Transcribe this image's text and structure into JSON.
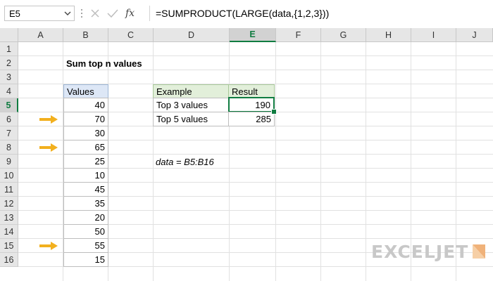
{
  "formula_bar": {
    "name_box": "E5",
    "fx_symbol": "fx",
    "formula": "=SUMPRODUCT(LARGE(data,{1,2,3}))"
  },
  "grid": {
    "columns": [
      "A",
      "B",
      "C",
      "D",
      "E",
      "F",
      "G",
      "H",
      "I",
      "J"
    ],
    "rows": [
      "1",
      "2",
      "3",
      "4",
      "5",
      "6",
      "7",
      "8",
      "9",
      "10",
      "11",
      "12",
      "13",
      "14",
      "15",
      "16"
    ],
    "selected_column": "E",
    "selected_row": "5"
  },
  "sheet": {
    "title": "Sum top n values",
    "values_header": "Values",
    "values": [
      "40",
      "70",
      "30",
      "65",
      "25",
      "10",
      "45",
      "35",
      "20",
      "50",
      "55",
      "15"
    ],
    "highlighted_values": [
      "70",
      "65",
      "55"
    ],
    "table": {
      "headers": [
        "Example",
        "Result"
      ],
      "rows": [
        {
          "example": "Top 3 values",
          "result": "190"
        },
        {
          "example": "Top 5 values",
          "result": "285"
        }
      ]
    },
    "note": "data = B5:B16"
  },
  "branding": {
    "logo_text": "EXCELJET"
  },
  "colors": {
    "arrow": "#f2b01e",
    "selection": "#107c41",
    "values_header_fill": "#dde7f6",
    "table_header_fill": "#e2efda"
  }
}
